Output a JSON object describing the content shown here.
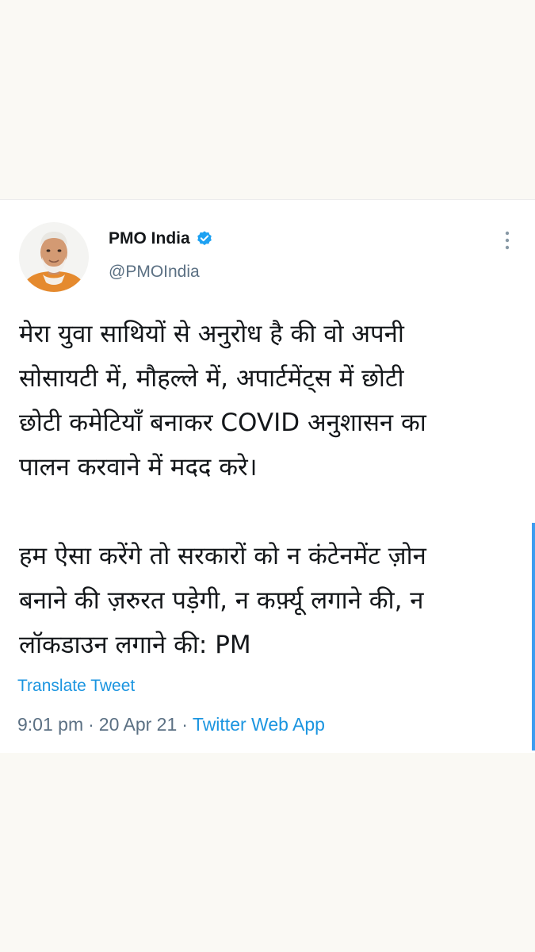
{
  "tweet": {
    "author": {
      "display_name": "PMO India",
      "handle": "@PMOIndia",
      "verified_icon": "verified-badge-icon",
      "avatar_icon": "profile-avatar"
    },
    "more_icon": "more-vertical-icon",
    "paragraphs": [
      [
        "मेरा युवा साथियों से अनुरोध है की वो अपनी",
        "सोसायटी में, मौहल्ले में, अपार्टमेंट्स में छोटी",
        "छोटी कमेटियाँ बनाकर COVID अनुशासन का",
        "पालन करवाने में मदद करे।"
      ],
      [
        "हम ऐसा करेंगे तो सरकारों को न कंटेनमेंट ज़ोन",
        "बनाने की ज़रुरत पड़ेगी, न कर्फ़्यू लगाने की, न",
        "लॉकडाउन लगाने की: PM"
      ]
    ],
    "translate_label": "Translate Tweet",
    "time": "9:01 pm",
    "separator": "·",
    "date": "20 Apr 21",
    "source": "Twitter Web App"
  },
  "colors": {
    "page_background": "#faf9f4",
    "card_background": "#ffffff",
    "text": "#14171a",
    "secondary_text": "#5b7083",
    "link": "#1b95e0",
    "verified": "#1da1f2",
    "scroll_indicator": "#3d9df0"
  }
}
